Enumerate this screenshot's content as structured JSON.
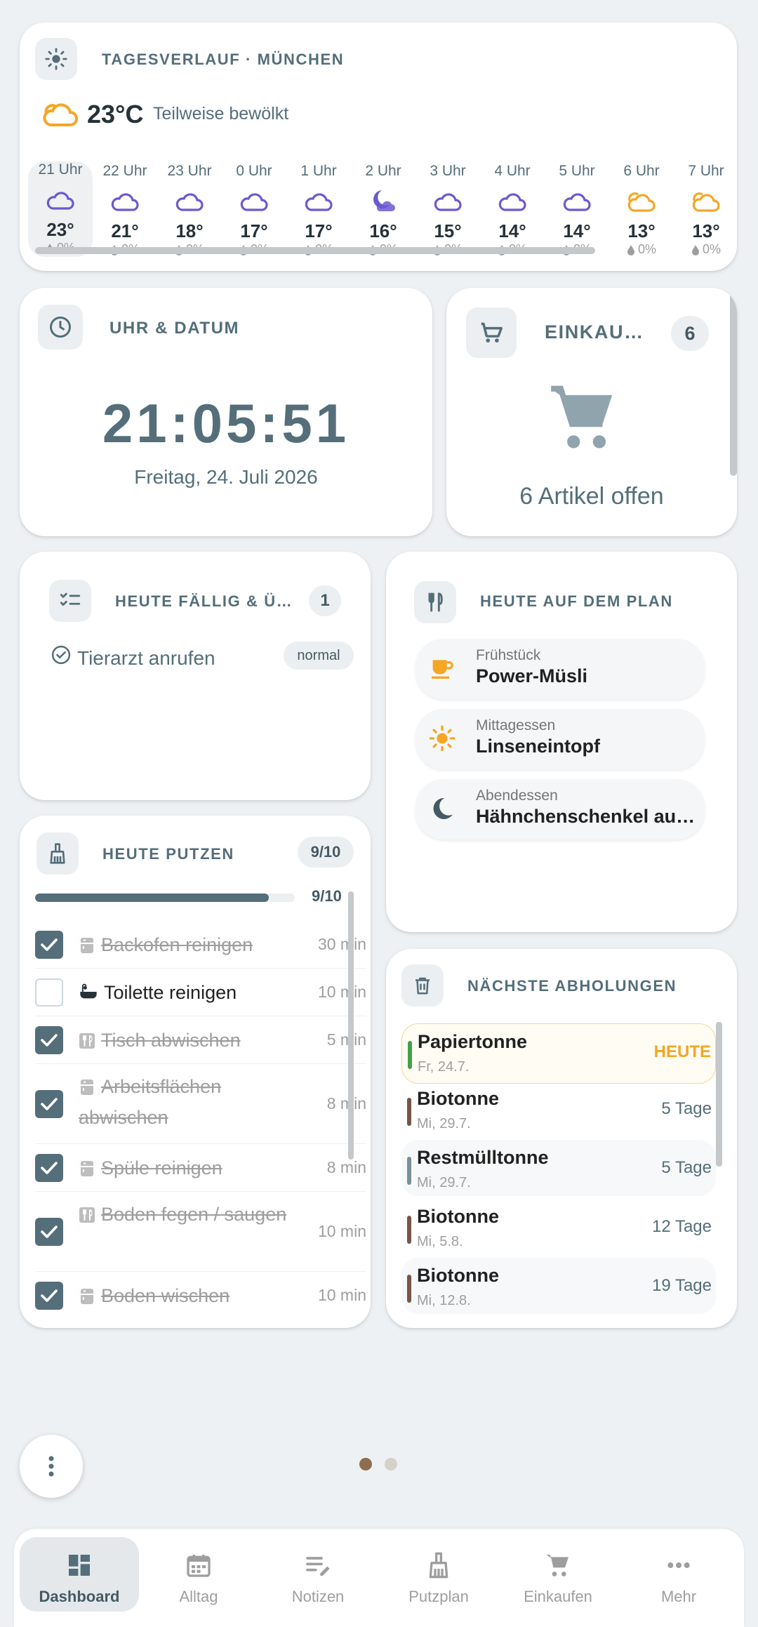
{
  "weather": {
    "title": "Tagesverlauf · München",
    "current_temp": "23°C",
    "current_desc": "Teilweise bewölkt",
    "hours": [
      {
        "time": "21 Uhr",
        "icon": "cloud-icon",
        "temp": "23°",
        "precip": "0%"
      },
      {
        "time": "22 Uhr",
        "icon": "cloud-icon",
        "temp": "21°",
        "precip": "0%"
      },
      {
        "time": "23 Uhr",
        "icon": "cloud-icon",
        "temp": "18°",
        "precip": "0%"
      },
      {
        "time": "0 Uhr",
        "icon": "cloud-icon",
        "temp": "17°",
        "precip": "0%"
      },
      {
        "time": "1 Uhr",
        "icon": "cloud-icon",
        "temp": "17°",
        "precip": "0%"
      },
      {
        "time": "2 Uhr",
        "icon": "moon-cloud-icon",
        "temp": "16°",
        "precip": "0%"
      },
      {
        "time": "3 Uhr",
        "icon": "cloud-icon",
        "temp": "15°",
        "precip": "0%"
      },
      {
        "time": "4 Uhr",
        "icon": "cloud-icon",
        "temp": "14°",
        "precip": "0%"
      },
      {
        "time": "5 Uhr",
        "icon": "cloud-icon",
        "temp": "14°",
        "precip": "0%"
      },
      {
        "time": "6 Uhr",
        "icon": "sun-cloud-icon",
        "temp": "13°",
        "precip": "0%"
      },
      {
        "time": "7 Uhr",
        "icon": "sun-cloud-icon",
        "temp": "13°",
        "precip": "0%"
      }
    ]
  },
  "clock": {
    "title": "Uhr & Datum",
    "time": "21:05:51",
    "date": "Freitag, 24. Juli 2026"
  },
  "shopping": {
    "title": "Einkau…",
    "count": "6",
    "summary": "6 Artikel offen"
  },
  "due": {
    "title": "Heute fällig & Ü…",
    "count": "1",
    "items": [
      {
        "name": "Tierarzt anrufen",
        "priority": "normal"
      }
    ]
  },
  "meals": {
    "title": "Heute auf dem Plan",
    "items": [
      {
        "label": "Frühstück",
        "name": "Power-Müsli",
        "icon": "coffee-cup-icon"
      },
      {
        "label": "Mittagessen",
        "name": "Linseneintopf",
        "icon": "sun-icon"
      },
      {
        "label": "Abendessen",
        "name": "Hähnchenschenkel aus dem Ofen",
        "icon": "moon-icon"
      }
    ]
  },
  "cleaning": {
    "title": "Heute putzen",
    "badge": "9/10",
    "progress_label": "9/10",
    "progress": 0.9,
    "tasks": [
      {
        "name": "Backofen reinigen",
        "minutes": "30 min",
        "done": true,
        "icon": "kitchen-icon"
      },
      {
        "name": "Toilette reinigen",
        "minutes": "10 min",
        "done": false,
        "icon": "bathtub-icon"
      },
      {
        "name": "Tisch abwischen",
        "minutes": "5 min",
        "done": true,
        "icon": "dining-icon"
      },
      {
        "name": "Arbeitsflächen abwischen",
        "minutes": "8 min",
        "done": true,
        "icon": "kitchen-icon"
      },
      {
        "name": "Spüle reinigen",
        "minutes": "8 min",
        "done": true,
        "icon": "kitchen-icon"
      },
      {
        "name": "Boden fegen / saugen",
        "minutes": "10 min",
        "done": true,
        "icon": "dining-icon"
      },
      {
        "name": "Boden wischen",
        "minutes": "10 min",
        "done": true,
        "icon": "kitchen-icon"
      }
    ]
  },
  "waste": {
    "title": "Nächste Abholungen",
    "items": [
      {
        "name": "Papiertonne",
        "date": "Fr, 24.7.",
        "due": "HEUTE",
        "color": "#43a047"
      },
      {
        "name": "Biotonne",
        "date": "Mi, 29.7.",
        "due": "5 Tage",
        "color": "#795548"
      },
      {
        "name": "Restmülltonne",
        "date": "Mi, 29.7.",
        "due": "5 Tage",
        "color": "#78909c"
      },
      {
        "name": "Biotonne",
        "date": "Mi, 5.8.",
        "due": "12 Tage",
        "color": "#795548"
      },
      {
        "name": "Biotonne",
        "date": "Mi, 12.8.",
        "due": "19 Tage",
        "color": "#795548"
      }
    ]
  },
  "pager": {
    "pages": 2,
    "active": 0
  },
  "nav": {
    "items": [
      {
        "label": "Dashboard",
        "icon": "dashboard-icon",
        "active": true
      },
      {
        "label": "Alltag",
        "icon": "calendar-icon",
        "active": false
      },
      {
        "label": "Notizen",
        "icon": "notes-icon",
        "active": false
      },
      {
        "label": "Putzplan",
        "icon": "broom-icon",
        "active": false
      },
      {
        "label": "Einkaufen",
        "icon": "cart-icon",
        "active": false
      },
      {
        "label": "Mehr",
        "icon": "more-icon",
        "active": false
      }
    ]
  },
  "colors": {
    "accent": "#546e7a",
    "today": "#f5a623",
    "moon": "#6a5acd",
    "cloud": "#6a5acd"
  }
}
